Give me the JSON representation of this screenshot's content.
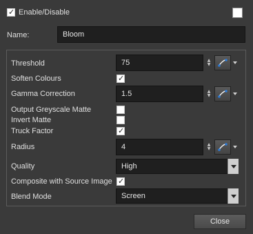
{
  "enable": {
    "label": "Enable/Disable",
    "checked": true
  },
  "color_swatch": "#ffffff",
  "name": {
    "label": "Name:",
    "value": "Bloom"
  },
  "params": {
    "threshold": {
      "label": "Threshold",
      "value": "75"
    },
    "soften_colours": {
      "label": "Soften Colours",
      "checked": true
    },
    "gamma_correction": {
      "label": "Gamma Correction",
      "value": "1.5"
    },
    "output_greyscale_matte": {
      "label": "Output Greyscale Matte",
      "checked": false
    },
    "invert_matte": {
      "label": "Invert Matte",
      "checked": false
    },
    "truck_factor": {
      "label": "Truck Factor",
      "checked": true
    },
    "radius": {
      "label": "Radius",
      "value": "4"
    },
    "quality": {
      "label": "Quality",
      "value": "High"
    },
    "composite_with_source": {
      "label": "Composite with Source Image",
      "checked": true
    },
    "blend_mode": {
      "label": "Blend Mode",
      "value": "Screen"
    }
  },
  "close_label": "Close",
  "icons": {
    "check": "✓",
    "function_curve": "function-curve-icon",
    "spin": "spinner-arrows-icon",
    "dropdown": "chevron-down-icon"
  }
}
